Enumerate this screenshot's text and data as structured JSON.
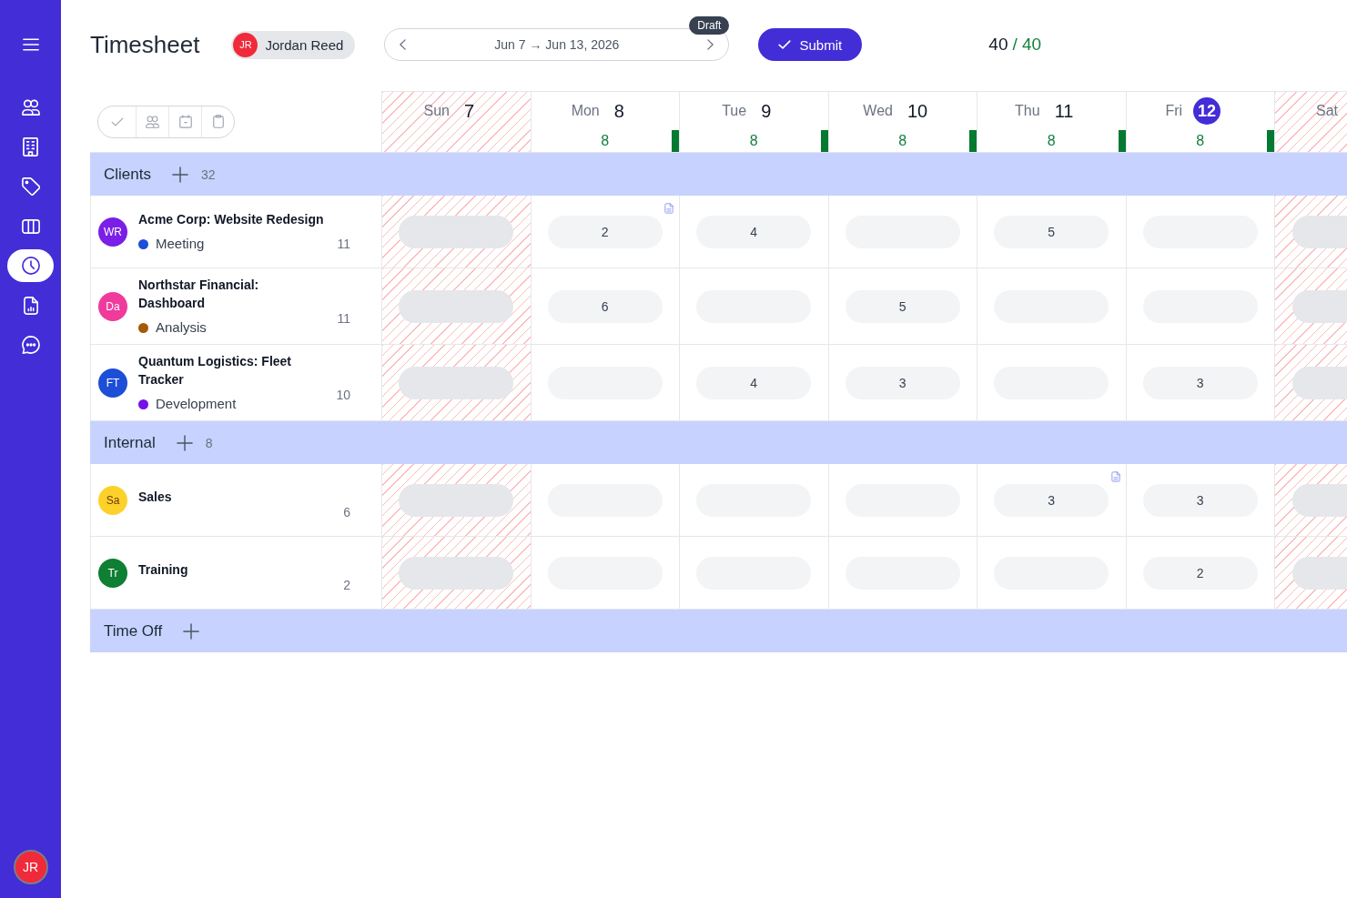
{
  "sidebar": {
    "items": [
      {
        "selected": false
      },
      {
        "selected": false
      },
      {
        "selected": false
      },
      {
        "selected": false
      },
      {
        "selected": true
      },
      {
        "selected": false
      },
      {
        "selected": false
      }
    ],
    "user": {
      "initials": "JR"
    }
  },
  "header": {
    "title": "Timesheet",
    "user": {
      "initials": "JR",
      "name": "Jordan Reed"
    },
    "week": {
      "label": "Jun 7 → Jun 13, 2026",
      "status": "Draft"
    },
    "submit": {
      "label": "Submit"
    },
    "hours": {
      "logged": "40",
      "target": "/ 40"
    }
  },
  "days": [
    {
      "day": "Sun",
      "date": "7",
      "weekend": true,
      "today": false
    },
    {
      "day": "Mon",
      "date": "8",
      "weekend": false,
      "today": false,
      "total": "8",
      "level": 1
    },
    {
      "day": "Tue",
      "date": "9",
      "weekend": false,
      "today": false,
      "total": "8",
      "level": 1
    },
    {
      "day": "Wed",
      "date": "10",
      "weekend": false,
      "today": false,
      "total": "8",
      "level": 1
    },
    {
      "day": "Thu",
      "date": "11",
      "weekend": false,
      "today": false,
      "total": "8",
      "level": 1
    },
    {
      "day": "Fri",
      "date": "12",
      "weekend": false,
      "today": true,
      "total": "8",
      "level": 1
    },
    {
      "day": "Sat",
      "weekend": true
    }
  ],
  "groups": [
    {
      "name": "Clients",
      "total": "32",
      "rows": [
        {
          "avatar": {
            "initials": "WR",
            "color": "#7a1fe6"
          },
          "title": "Acme Corp: Website Redesign",
          "tag": {
            "label": "Meeting",
            "color": "#1d4ed8"
          },
          "total": "11",
          "cells": [
            {
              "note": false
            },
            {
              "hours": "2",
              "note": true
            },
            {
              "hours": "4",
              "note": false
            },
            {
              "note": false
            },
            {
              "hours": "5",
              "note": false
            },
            {
              "note": false
            },
            {
              "note": false
            }
          ]
        },
        {
          "avatar": {
            "initials": "Da",
            "color": "#f03a9c"
          },
          "title": "Northstar Financial: Dashboard",
          "tag": {
            "label": "Analysis",
            "color": "#a45a06"
          },
          "total": "11",
          "cells": [
            {
              "note": false
            },
            {
              "hours": "6",
              "note": false
            },
            {
              "note": false
            },
            {
              "hours": "5",
              "note": false
            },
            {
              "note": false
            },
            {
              "note": false
            },
            {
              "note": false
            }
          ]
        },
        {
          "avatar": {
            "initials": "FT",
            "color": "#1d4ed8"
          },
          "title": "Quantum Logistics: Fleet Tracker",
          "tag": {
            "label": "Development",
            "color": "#7412e8"
          },
          "total": "10",
          "cells": [
            {
              "note": false
            },
            {
              "note": false
            },
            {
              "hours": "4",
              "note": false
            },
            {
              "hours": "3",
              "note": false
            },
            {
              "note": false
            },
            {
              "hours": "3",
              "note": false
            },
            {
              "note": false
            }
          ]
        }
      ]
    },
    {
      "name": "Internal",
      "total": "8",
      "rows": [
        {
          "avatar": {
            "initials": "Sa",
            "color": "#fcd12a"
          },
          "title": "Sales",
          "total": "6",
          "cells": [
            {
              "note": false
            },
            {
              "note": false
            },
            {
              "note": false
            },
            {
              "note": false
            },
            {
              "hours": "3",
              "note": true
            },
            {
              "hours": "3",
              "note": false
            },
            {
              "note": false
            }
          ]
        },
        {
          "avatar": {
            "initials": "Tr",
            "color": "#0e7f33"
          },
          "title": "Training",
          "total": "2",
          "cells": [
            {
              "note": false
            },
            {
              "note": false
            },
            {
              "note": false
            },
            {
              "note": false
            },
            {
              "note": false
            },
            {
              "hours": "2",
              "note": false
            },
            {
              "note": false
            }
          ]
        }
      ]
    },
    {
      "name": "Time Off"
    }
  ]
}
